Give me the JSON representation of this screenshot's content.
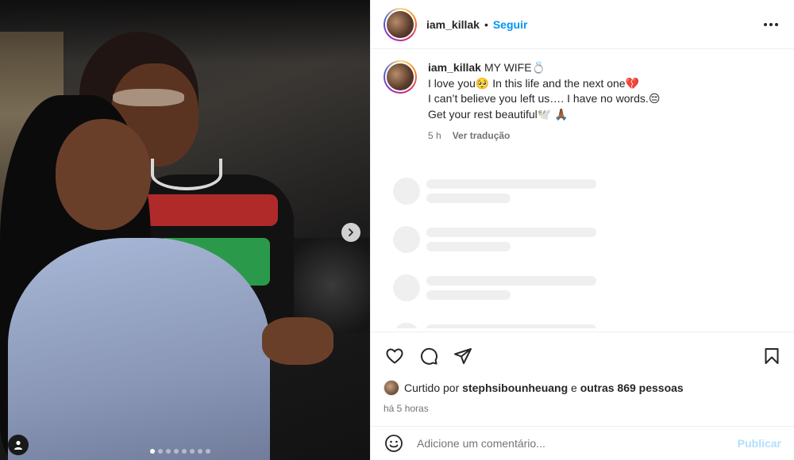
{
  "post": {
    "username": "iam_killak",
    "separator": "•",
    "follow_label": "Seguir",
    "more_icon": "more-horizontal-icon",
    "photo": {
      "carousel_total": 8,
      "carousel_index": 1,
      "next_icon": "chevron-right-icon",
      "tag_icon": "user-tag-icon"
    }
  },
  "caption": {
    "username": "iam_killak",
    "lines": [
      "MY WIFE💍",
      "I love you🥺  In this life and the next one💔",
      "I can’t believe you left us…. I have no words.😔",
      "Get your rest beautiful🕊️ 🙏🏾"
    ],
    "time": "5 h",
    "translate_label": "Ver tradução"
  },
  "comments_loading_count": 4,
  "actions": {
    "like_icon": "heart-icon",
    "comment_icon": "comment-icon",
    "share_icon": "share-icon",
    "save_icon": "bookmark-icon"
  },
  "likes": {
    "prefix": "Curtido por",
    "user": "stephsibounheuang",
    "conj": "e",
    "others": "outras 869 pessoas"
  },
  "timestamp": "há 5 horas",
  "comment_box": {
    "emoji_icon": "smiley-icon",
    "placeholder": "Adicione um comentário...",
    "publish_label": "Publicar"
  },
  "colors": {
    "accent": "#0095f6",
    "publish_disabled": "#b2dffc",
    "muted": "#737373",
    "text": "#262626"
  }
}
